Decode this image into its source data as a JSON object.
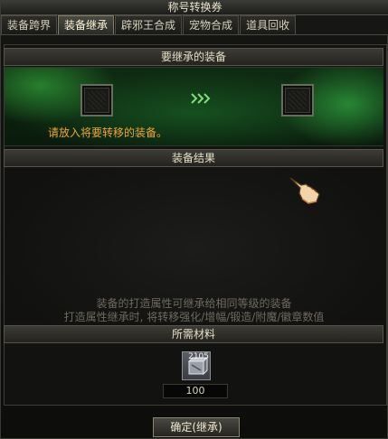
{
  "window": {
    "title": "称号转换券"
  },
  "tabs": [
    {
      "label": "装备跨界",
      "active": false
    },
    {
      "label": "装备继承",
      "active": true
    },
    {
      "label": "辟邪王合成",
      "active": false
    },
    {
      "label": "宠物合成",
      "active": false
    },
    {
      "label": "道具回收",
      "active": false
    }
  ],
  "inherit": {
    "header": "要继承的装备",
    "hint": "请放入将要转移的装备。"
  },
  "result": {
    "header": "装备结果",
    "desc_line1": "装备的打造属性可继承给相同等级的装备",
    "desc_line2": "打造属性继承时, 将转移强化/增幅/锻造/附魔/徽章数值"
  },
  "materials": {
    "header": "所需材料",
    "item_count": "2105",
    "quantity": "100"
  },
  "confirm_button": {
    "label": "确定(继承)"
  },
  "colors": {
    "hint": "#f0a630",
    "accent_green": "#3cc846"
  }
}
